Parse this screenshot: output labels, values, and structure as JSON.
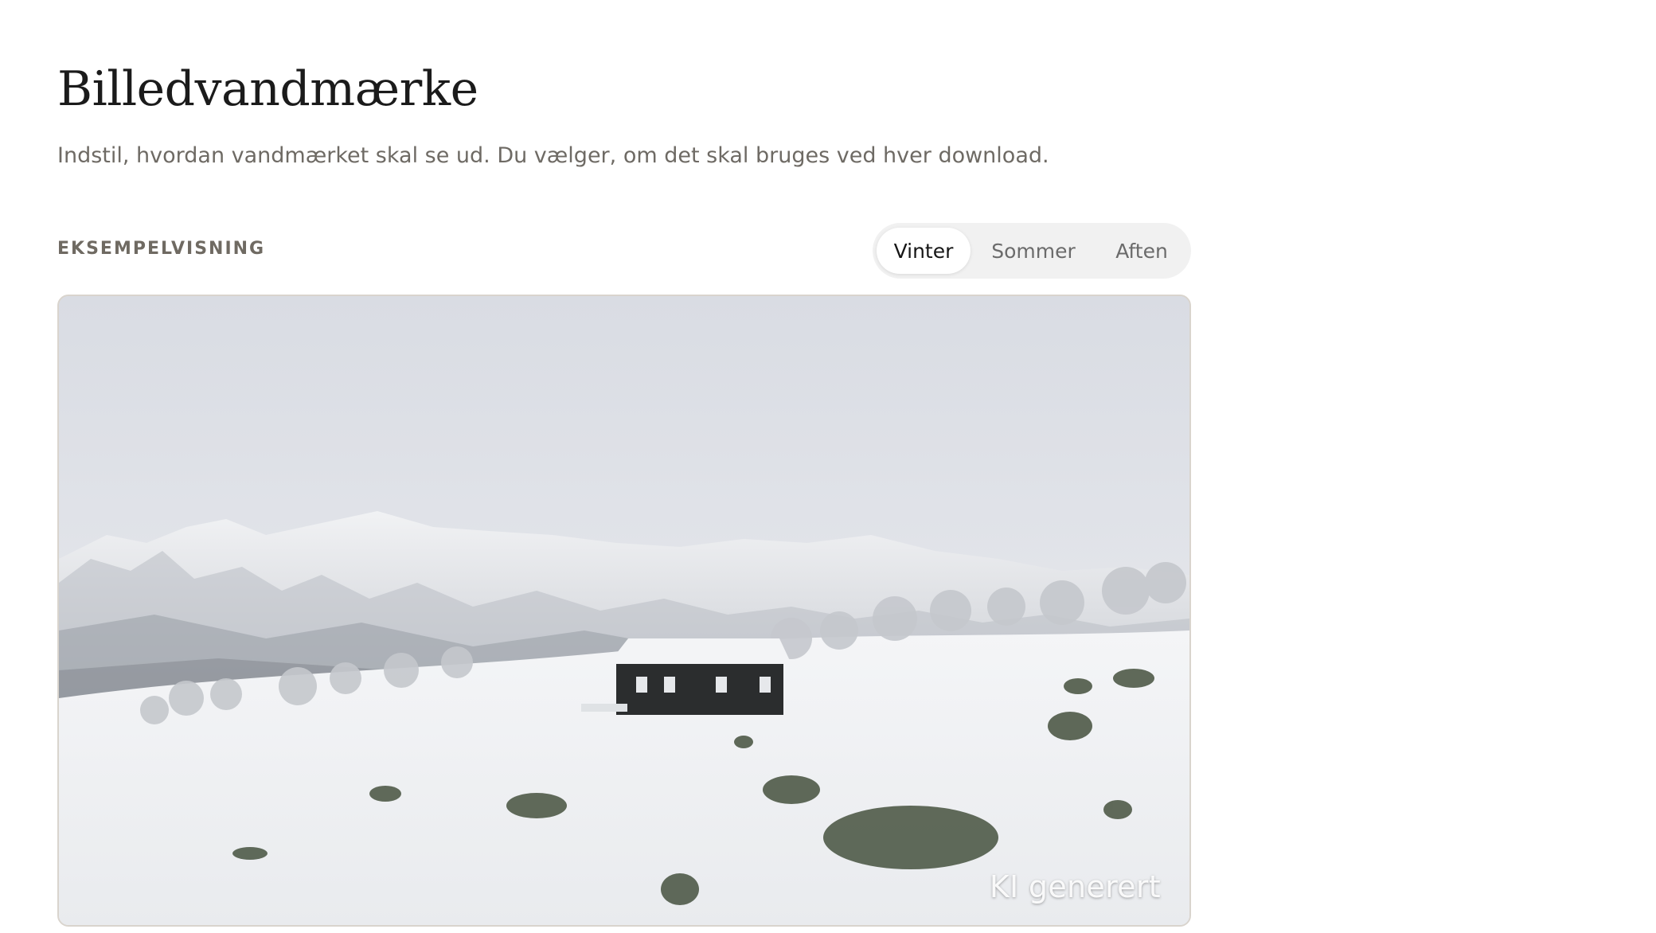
{
  "header": {
    "title": "Billedvandmærke",
    "subtitle": "Indstil, hvordan vandmærket skal se ud. Du vælger, om det skal bruges ved hver download."
  },
  "preview": {
    "section_label": "EKSEMPELVISNING",
    "tabs": [
      {
        "label": "Vinter",
        "active": true
      },
      {
        "label": "Sommer",
        "active": false
      },
      {
        "label": "Aften",
        "active": false
      }
    ],
    "image_subject": "snowy mountain landscape with a dark wooden cabin",
    "watermark_text": "KI generert"
  },
  "colors": {
    "title": "#1b1b1b",
    "subtitle": "#6e6a64",
    "tab_bg": "#f1f1f1",
    "tab_active_bg": "#ffffff",
    "preview_border": "#d9d4cd"
  }
}
